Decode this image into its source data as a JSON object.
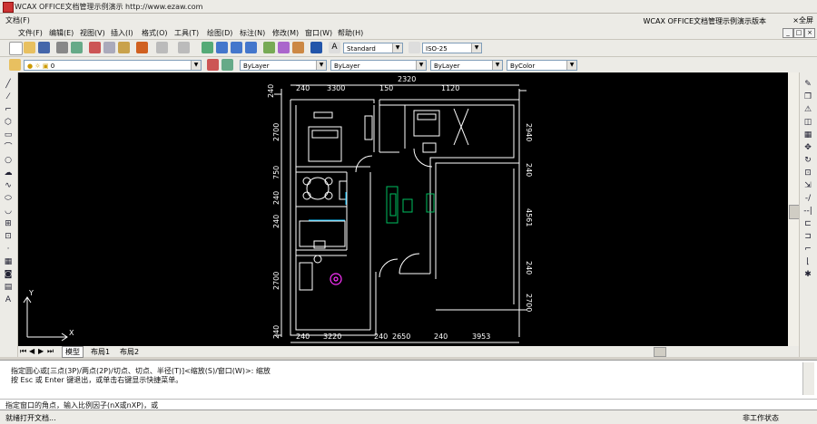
{
  "window": {
    "title": "WCAX OFFICE文档管理示例演示 http://www.ezaw.com"
  },
  "menubar": {
    "brand": "WCAX OFFICE文档管理示例演示版本",
    "close": "×全屏",
    "doc_label": "文档(F)"
  },
  "menus": [
    "文件(F)",
    "编辑(E)",
    "视图(V)",
    "插入(I)",
    "格式(O)",
    "工具(T)",
    "绘图(D)",
    "标注(N)",
    "修改(M)",
    "窗口(W)",
    "帮助(H)"
  ],
  "toolbar": {
    "text_style": "Standard",
    "dim_style": "ISO-25"
  },
  "layers": {
    "current": "0",
    "color": "ByLayer",
    "linetype": "ByLayer",
    "lineweight": "ByLayer",
    "plotstyle": "ByColor"
  },
  "drawing": {
    "top_dims": [
      "240",
      "3300",
      "150",
      "2320",
      "1120"
    ],
    "bottom_dims": [
      "240",
      "3220",
      "240",
      "2650",
      "240",
      "3953"
    ],
    "left_dims": [
      "240",
      "2700",
      "750",
      "240",
      "240",
      "2700",
      "240"
    ],
    "right_dims": [
      "2940",
      "240",
      "4561",
      "240",
      "2700"
    ]
  },
  "tabs": [
    "模型",
    "布局1",
    "布局2"
  ],
  "command": {
    "line1": "指定圆心或[三点(3P)/两点(2P)/切点、切点、半径(T)]<缩放(S)/窗口(W)>: 缩放",
    "line2": "按 Esc 或 Enter 键退出，或单击右键显示快捷菜单。",
    "prompt": "指定窗口的角点，输入比例因子(nX或nXP)，或"
  },
  "status": {
    "left": "就绪打开文档...",
    "right": "非工作状态"
  },
  "colors": {
    "canvas": "#000000",
    "chrome": "#ecebe6",
    "walls": "#ffffff",
    "accent_green": "#00c060",
    "accent_magenta": "#ff33ff"
  }
}
